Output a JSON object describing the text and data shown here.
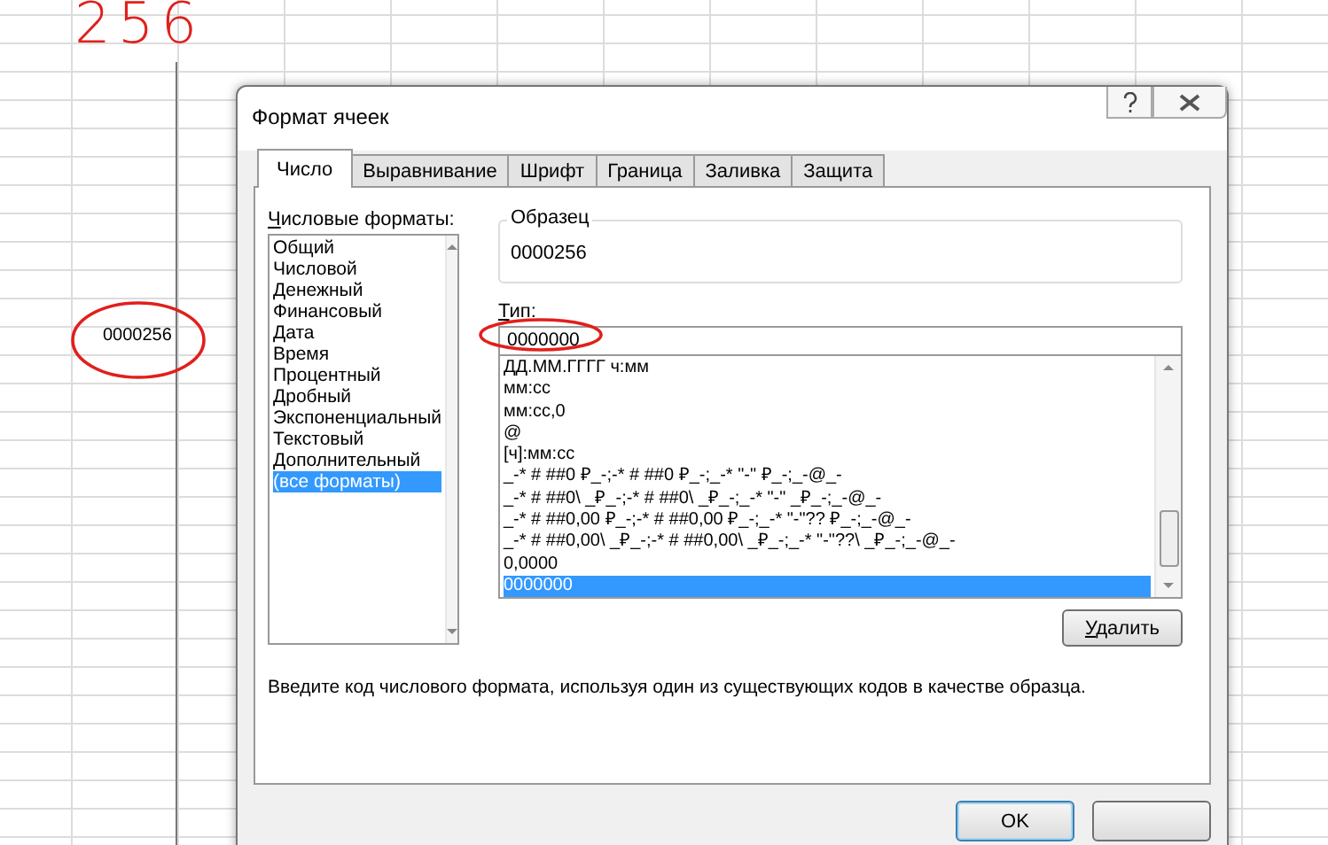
{
  "annotation": {
    "text": "256"
  },
  "sheet": {
    "cell_value": "0000256"
  },
  "dialog": {
    "title": "Формат ячеек",
    "tabs": [
      {
        "label": "Число",
        "selected": true
      },
      {
        "label": "Выравнивание",
        "selected": false
      },
      {
        "label": "Шрифт",
        "selected": false
      },
      {
        "label": "Граница",
        "selected": false
      },
      {
        "label": "Заливка",
        "selected": false
      },
      {
        "label": "Защита",
        "selected": false
      }
    ],
    "categories_label": "Числовые форматы:",
    "categories": [
      {
        "label": "Общий",
        "selected": false
      },
      {
        "label": "Числовой",
        "selected": false
      },
      {
        "label": "Денежный",
        "selected": false
      },
      {
        "label": "Финансовый",
        "selected": false
      },
      {
        "label": "Дата",
        "selected": false
      },
      {
        "label": "Время",
        "selected": false
      },
      {
        "label": "Процентный",
        "selected": false
      },
      {
        "label": "Дробный",
        "selected": false
      },
      {
        "label": "Экспоненциальный",
        "selected": false
      },
      {
        "label": "Текстовый",
        "selected": false
      },
      {
        "label": "Дополнительный",
        "selected": false
      },
      {
        "label": "(все форматы)",
        "selected": true
      }
    ],
    "sample": {
      "legend": "Образец",
      "value": "0000256"
    },
    "type_label": "Тип:",
    "type_value": "0000000",
    "formats": [
      {
        "label": "ДД.ММ.ГГГГ ч:мм",
        "selected": false
      },
      {
        "label": "мм:сс",
        "selected": false
      },
      {
        "label": "мм:сс,0",
        "selected": false
      },
      {
        "label": "@",
        "selected": false
      },
      {
        "label": "[ч]:мм:сс",
        "selected": false
      },
      {
        "label": "_-* # ##0 ₽_-;-* # ##0 ₽_-;_-* \"-\" ₽_-;_-@_-",
        "selected": false
      },
      {
        "label": "_-* # ##0\\ _₽_-;-* # ##0\\ _₽_-;_-* \"-\" _₽_-;_-@_-",
        "selected": false
      },
      {
        "label": "_-* # ##0,00 ₽_-;-* # ##0,00 ₽_-;_-* \"-\"?? ₽_-;_-@_-",
        "selected": false
      },
      {
        "label": "_-* # ##0,00\\ _₽_-;-* # ##0,00\\ _₽_-;_-* \"-\"??\\ _₽_-;_-@_-",
        "selected": false
      },
      {
        "label": "0,0000",
        "selected": false
      },
      {
        "label": "0000000",
        "selected": true
      }
    ],
    "delete_button": "Удалить",
    "hint": "Введите код числового формата, используя один из существующих кодов в качестве образца.",
    "buttons": [
      {
        "label": "OK",
        "kind": "default"
      },
      {
        "kind": "hidden"
      }
    ]
  }
}
